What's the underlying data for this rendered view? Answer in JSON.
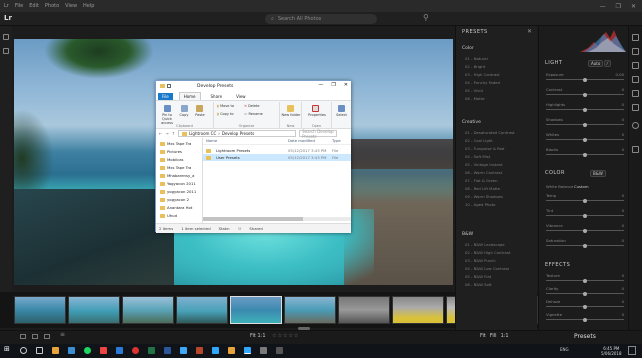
{
  "menubar": {
    "items": [
      "Lr",
      "File",
      "Edit",
      "Photo",
      "View",
      "Help"
    ],
    "window_controls": [
      "—",
      "❐",
      "✕"
    ]
  },
  "topbar": {
    "logo": "Lr",
    "search_placeholder": "Search All Photos"
  },
  "explorer": {
    "title": "Develop Presets",
    "tabs": [
      "File",
      "Home",
      "Share",
      "View"
    ],
    "ribbon": {
      "pin": "Pin to Quick access",
      "copy": "Copy",
      "paste": "Paste",
      "clipboard": "Clipboard",
      "move_to": "Move to",
      "copy_to": "Copy to",
      "delete": "Delete",
      "rename": "Rename",
      "organize": "Organize",
      "new_folder": "New folder",
      "new": "New",
      "properties": "Properties",
      "open": "Open",
      "select": "Select"
    },
    "address": [
      "Lightroom CC",
      "Develop Presets"
    ],
    "search_placeholder": "Search Develop Presets",
    "nav_items": [
      "Mxs Tape Tra",
      "Pictures",
      "Mobilcas",
      "Mxs Tape Tra",
      "Mhabarensy_a",
      "Yogyacon 2011",
      "yogyacon 2011",
      "yogyacon 2",
      "Anantara Hot",
      "Uhud"
    ],
    "columns": [
      "Name",
      "Date modified",
      "Type"
    ],
    "rows": [
      {
        "name": "Lightroom Presets",
        "date": "05/12/2017 3:43 PM",
        "type": "File"
      },
      {
        "name": "User Presets",
        "date": "05/12/2017 3:43 PM",
        "type": "File"
      }
    ],
    "status": {
      "count": "2 items",
      "selected": "1 item selected",
      "state_label": "State:",
      "state": "Shared"
    }
  },
  "presets_panel": {
    "title": "PRESETS",
    "groups": [
      {
        "name": "Color",
        "items": [
          "01 - Natural",
          "02 - Bright",
          "03 - High Contrast",
          "04 - Punchy Faded",
          "05 - Vivid",
          "06 - Matte"
        ]
      },
      {
        "name": "Creative",
        "items": [
          "01 - Desaturated Contrast",
          "02 - Cool Light",
          "03 - Turquoise & Red",
          "04 - Soft Mist",
          "05 - Vintage Instant",
          "06 - Warm Contrast",
          "07 - Flat & Green",
          "08 - Red Lift Matte",
          "09 - Warm Shadows",
          "10 - Aged Photo"
        ]
      },
      {
        "name": "B&W",
        "items": [
          "01 - B&W Landscape",
          "02 - B&W High Contrast",
          "03 - B&W Punch",
          "04 - B&W Low Contrast",
          "05 - B&W Flat",
          "06 - B&W Soft"
        ]
      }
    ]
  },
  "edit_panel": {
    "light": {
      "title": "LIGHT",
      "auto": "Auto",
      "sliders": [
        {
          "label": "Exposure",
          "value": "0.00",
          "pos": 0.5
        },
        {
          "label": "Contrast",
          "value": "0",
          "pos": 0.5
        },
        {
          "label": "Highlights",
          "value": "0",
          "pos": 0.5
        },
        {
          "label": "Shadows",
          "value": "0",
          "pos": 0.5
        },
        {
          "label": "Whites",
          "value": "0",
          "pos": 0.5
        },
        {
          "label": "Blacks",
          "value": "0",
          "pos": 0.5
        }
      ]
    },
    "color": {
      "title": "COLOR",
      "bw": "B&W",
      "wb_label": "White Balance",
      "wb_value": "Custom",
      "sliders": [
        {
          "label": "Temp",
          "value": "0",
          "pos": 0.5
        },
        {
          "label": "Tint",
          "value": "0",
          "pos": 0.5
        },
        {
          "label": "Vibrance",
          "value": "0",
          "pos": 0.5
        },
        {
          "label": "Saturation",
          "value": "0",
          "pos": 0.5
        }
      ]
    },
    "effects": {
      "title": "EFFECTS",
      "sliders": [
        {
          "label": "Texture",
          "value": "0",
          "pos": 0.5
        },
        {
          "label": "Clarity",
          "value": "0",
          "pos": 0.5
        },
        {
          "label": "Dehaze",
          "value": "0",
          "pos": 0.5
        },
        {
          "label": "Vignette",
          "value": "0",
          "pos": 0.5
        }
      ]
    }
  },
  "bottombar": {
    "fit": "Fit",
    "zoom": "1:1",
    "stars": "☆☆☆☆☆",
    "right_items": [
      "Fit",
      "Fill",
      "1:1"
    ],
    "presets_button": "Presets"
  },
  "taskbar": {
    "time": "6:45 PM",
    "date": "5/06/2018",
    "lang": "ENG"
  }
}
